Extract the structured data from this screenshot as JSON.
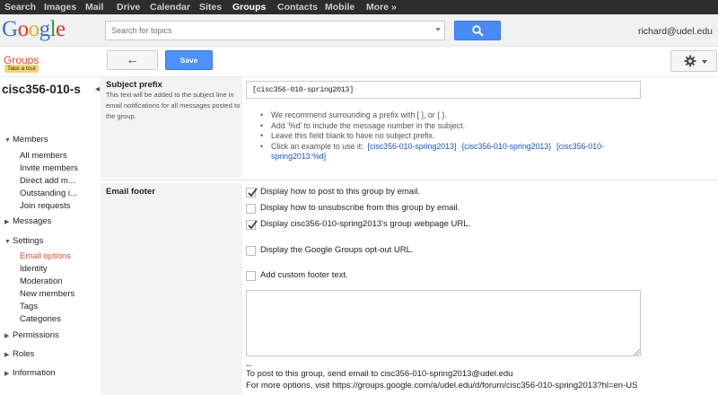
{
  "topnav": {
    "items": [
      "Search",
      "Images",
      "Mail",
      "Drive",
      "Calendar",
      "Sites",
      "Groups",
      "Contacts",
      "Mobile",
      "More »"
    ],
    "active": "Groups"
  },
  "header": {
    "logo_text": "Google",
    "search_placeholder": "Search for topics",
    "user_email": "richard@udel.edu"
  },
  "brand": {
    "groups": "Groups",
    "take_tour": "Take a tour"
  },
  "toolbar": {
    "back_label": "←",
    "save_label": "Save"
  },
  "sidebar": {
    "group_name": "cisc356-010-s",
    "collapse": "◂",
    "sections": [
      {
        "label": "Members",
        "expanded": true,
        "items": [
          "All members",
          "Invite members",
          "Direct add m...",
          "Outstanding i...",
          "Join requests"
        ]
      },
      {
        "label": "Messages",
        "expanded": false,
        "items": []
      },
      {
        "label": "Settings",
        "expanded": true,
        "items": [
          "Email options",
          "Identity",
          "Moderation",
          "New members",
          "Tags",
          "Categories"
        ]
      },
      {
        "label": "Permissions",
        "expanded": false,
        "items": []
      },
      {
        "label": "Roles",
        "expanded": false,
        "items": []
      },
      {
        "label": "Information",
        "expanded": false,
        "items": []
      }
    ],
    "active_item": "Email options"
  },
  "subject_prefix": {
    "title": "Subject prefix",
    "description": "This text will be added to the subject line in email notifications for all messages posted to the group.",
    "value": "[cisc356-010-spring2013]",
    "hints": [
      "We recommend surrounding a prefix with [ ], or { }.",
      "Add '%d' to include the message number in the subject.",
      "Leave this field blank to have no subject prefix."
    ],
    "example_intro": "Click an example to use it:",
    "examples": [
      "[cisc356-010-spring2013]",
      "{cisc356-010-spring2013}",
      "[cisc356-010-spring2013:%d]"
    ]
  },
  "email_footer": {
    "title": "Email footer",
    "options": [
      {
        "label": "Display how to post to this group by email.",
        "checked": true
      },
      {
        "label": "Display how to unsubscribe from this group by email.",
        "checked": false
      },
      {
        "label": "Display cisc356-010-spring2013's group webpage URL.",
        "checked": true
      },
      {
        "label": "Display the Google Groups opt-out URL.",
        "checked": false
      },
      {
        "label": "Add custom footer text.",
        "checked": false
      }
    ],
    "custom_text": "",
    "signature_dash": "--",
    "signature_line1": "To post to this group, send email to cisc356-010-spring2013@udel.edu",
    "signature_line2": "For more options, visit https://groups.google.com/a/udel.edu/d/forum/cisc356-010-spring2013?hl=en-US"
  },
  "colors": {
    "accent_blue": "#4d90fe",
    "brand_red": "#dd4b39",
    "link_blue": "#1155cc"
  }
}
